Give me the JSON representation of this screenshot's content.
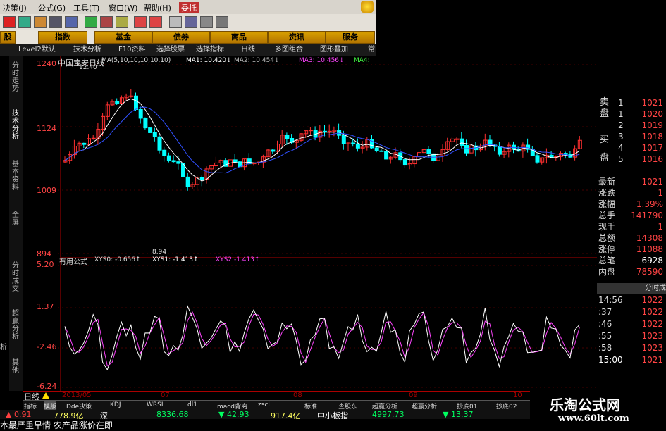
{
  "menu": [
    "决策(J)",
    "公式(G)",
    "工具(T)",
    "窗口(W)",
    "帮助(H)",
    "委托"
  ],
  "nav_buttons": [
    "股",
    "指数",
    "基金",
    "债券",
    "商品",
    "资讯",
    "服务"
  ],
  "tabs": [
    "Level2默认",
    "技术分析",
    "F10资料",
    "选择股票",
    "选择指标",
    "日线",
    "多图组合",
    "图形叠加",
    "常"
  ],
  "side_tabs": [
    "分时走势",
    "技术分析",
    "基本资料",
    "全屏",
    "分时成交",
    "超赢分析",
    "其他"
  ],
  "edge_label": "析",
  "chart": {
    "title": "中国宝安日线",
    "ma_label": "MA(5,10,10,10,10,10)",
    "ma1": "MA1: 10.420↓",
    "ma2": "MA2: 10.454↓",
    "ma3": "MA3: 10.456↓",
    "ma4": "MA4:",
    "high_mark": "12.40",
    "low_mark": "8.94",
    "price_ticks": [
      "1240",
      "1124",
      "1009",
      "894"
    ],
    "sub_title": "有用公式",
    "xys0": "XYS0: -0.656↑",
    "xys1": "XYS1: -1.413↑",
    "xys2": "XYS2 -1.413↑",
    "sub_ticks": [
      "5.20",
      "1.37",
      "-2.46",
      "-6.24"
    ],
    "date_labels": [
      "2013/05",
      "07",
      "08",
      "09",
      "10"
    ],
    "period_label": "日线",
    "colors": {
      "up": "#ff3030",
      "down": "#00ffff",
      "ma1": "#ffffff",
      "ma2": "#3050ff",
      "xys1": "#ffffff",
      "xys2": "#ff44ff"
    }
  },
  "orderbook": {
    "sell_label": "卖盘",
    "buy_label": "买盘",
    "rows": [
      {
        "n": "1",
        "price": "1021"
      },
      {
        "n": "1",
        "price": "1020"
      },
      {
        "n": "2",
        "price": "1019"
      },
      {
        "n": "3",
        "price": "1018"
      },
      {
        "n": "4",
        "price": "1017"
      },
      {
        "n": "5",
        "price": "1016"
      }
    ]
  },
  "quote": [
    {
      "label": "最新",
      "value": "1021"
    },
    {
      "label": "涨跌",
      "value": "1"
    },
    {
      "label": "涨幅",
      "value": "1.39%"
    },
    {
      "label": "总手",
      "value": "141790"
    },
    {
      "label": "现手",
      "value": "1"
    },
    {
      "label": "总额",
      "value": "14308"
    },
    {
      "label": "涨停",
      "value": "11088"
    },
    {
      "label": "总笔",
      "value": "6928"
    },
    {
      "label": "内盘",
      "value": "78590"
    }
  ],
  "ticks_header": "分时成",
  "ticks": [
    {
      "time": "14:56",
      "price": "1022"
    },
    {
      "time": ":37",
      "price": "1022"
    },
    {
      "time": ":46",
      "price": "1022"
    },
    {
      "time": ":55",
      "price": "1023"
    },
    {
      "time": ":58",
      "price": "1023"
    },
    {
      "time": "15:00",
      "price": "1021"
    }
  ],
  "bottom_tabs": [
    "指标",
    "模版",
    "Dde决策",
    "KDJ",
    "WRSI",
    "dl1",
    "macd背离",
    "zscl",
    "标准",
    "查股东",
    "超赢分析",
    "超赢分析",
    "抄底01",
    "抄底02"
  ],
  "status": [
    {
      "text": "▲ 0.91",
      "color": "#ff4040"
    },
    {
      "text": "778.9亿",
      "color": "#ffff60"
    },
    {
      "text": "深",
      "color": "#ffffff"
    },
    {
      "text": "8336.68",
      "color": "#00ff60"
    },
    {
      "text": "▼ 42.93",
      "color": "#00ff60"
    },
    {
      "text": "917.4亿",
      "color": "#ffff60"
    },
    {
      "text": "中小板指",
      "color": "#ffffff"
    },
    {
      "text": "4997.73",
      "color": "#00ff60"
    },
    {
      "text": "▼ 13.37",
      "color": "#00ff60"
    }
  ],
  "ticker_text": "本最严重旱情 农产品涨价在即",
  "brand": {
    "name": "乐淘公式网",
    "url": "www.60lt.com"
  }
}
